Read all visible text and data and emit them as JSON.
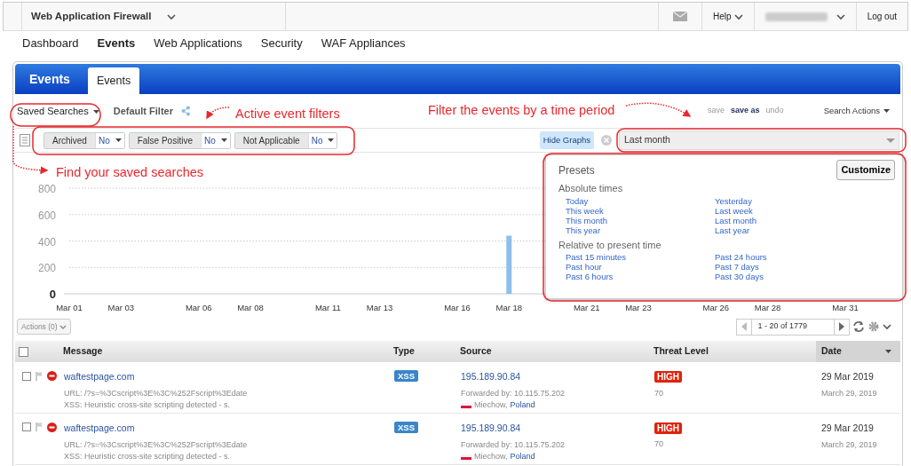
{
  "top_bar": {
    "app_title": "Web Application Firewall",
    "help": "Help",
    "logout": "Log out"
  },
  "main_nav": [
    {
      "label": "Dashboard",
      "selected": false
    },
    {
      "label": "Events",
      "selected": true
    },
    {
      "label": "Web Applications",
      "selected": false
    },
    {
      "label": "Security",
      "selected": false
    },
    {
      "label": "WAF Appliances",
      "selected": false
    }
  ],
  "panel": {
    "title": "Events",
    "tabs": [
      {
        "label": "Events",
        "selected": true
      }
    ]
  },
  "search_bar": {
    "saved_searches": "Saved Searches",
    "filter_name": "Default Filter",
    "actions": [
      {
        "label": "save",
        "disabled": true
      },
      {
        "label": "save as",
        "disabled": false
      },
      {
        "label": "undo",
        "disabled": true
      }
    ],
    "search_actions": "Search Actions"
  },
  "filters": [
    {
      "label": "Archived",
      "value": "No"
    },
    {
      "label": "False Positive",
      "value": "No"
    },
    {
      "label": "Not Applicable",
      "value": "No"
    }
  ],
  "hide_graphs": "Hide Graphs",
  "time_field": {
    "value": "Last month"
  },
  "time_presets": {
    "title": "Presets",
    "customize": "Customize",
    "groups": [
      {
        "title": "Absolute times",
        "columns": [
          [
            "Today",
            "This week",
            "This month",
            "This year"
          ],
          [
            "Yesterday",
            "Last week",
            "Last month",
            "Last year"
          ]
        ]
      },
      {
        "title": "Relative to present time",
        "columns": [
          [
            "Past 15 minutes",
            "Past hour",
            "Past 6 hours"
          ],
          [
            "Past 24 hours",
            "Past 7 days",
            "Past 30 days"
          ]
        ]
      }
    ]
  },
  "chart": {
    "chart_data": {
      "type": "bar",
      "grid": true,
      "ylim": [
        0,
        800
      ],
      "yticks": [
        0,
        200,
        400,
        600,
        800
      ],
      "categories": [
        "Mar 01",
        null,
        "Mar 03",
        null,
        null,
        "Mar 06",
        null,
        "Mar 08",
        null,
        null,
        "Mar 11",
        null,
        "Mar 13",
        null,
        null,
        "Mar 16",
        null,
        "Mar 18",
        null,
        null,
        "Mar 21",
        null,
        "Mar 23",
        null,
        null,
        "Mar 26",
        null,
        "Mar 28",
        null,
        null,
        "Mar 31"
      ],
      "values": [
        null,
        null,
        null,
        null,
        null,
        null,
        null,
        null,
        null,
        null,
        null,
        null,
        null,
        null,
        null,
        null,
        null,
        440,
        null,
        null,
        null,
        null,
        null,
        null,
        null,
        null,
        null,
        null,
        null,
        null,
        null
      ]
    }
  },
  "actions_button": "Actions (0)",
  "pager": "1 - 20 of 1779",
  "table": {
    "all_checked": false,
    "columns": [
      {
        "label": "Message",
        "sorted": false
      },
      {
        "label": "Type",
        "sorted": false
      },
      {
        "label": "Source",
        "sorted": false
      },
      {
        "label": "Threat Level",
        "sorted": false
      },
      {
        "label": "Date",
        "sorted": true
      }
    ],
    "rows": [
      {
        "checked": false,
        "message": "waftestpage.com",
        "url": "URL: /?s=%3Cscript%3E%3C%252Fscript%3Edate",
        "detail": "XSS: Heuristic cross-site scripting detected - s.",
        "type": "XSS",
        "source": "195.189.90.84",
        "forwarded": "Forwarded by: 10.115.75.202",
        "city": "Miechow,",
        "country": "Poland",
        "threat": "HIGH",
        "score": "70",
        "date": "29 Mar 2019",
        "date_long": "March 29, 2019"
      },
      {
        "checked": false,
        "message": "waftestpage.com",
        "url": "URL: /?s=%3Cscript%3E%3C%252Fscript%3Edate",
        "detail": "XSS: Heuristic cross-site scripting detected - s.",
        "type": "XSS",
        "source": "195.189.90.84",
        "forwarded": "Forwarded by: 10.115.75.202",
        "city": "Miechow,",
        "country": "Poland",
        "threat": "HIGH",
        "score": "70",
        "date": "29 Mar 2019",
        "date_long": "March 29, 2019"
      }
    ]
  },
  "annotations": [
    {
      "kind": "filters",
      "text": "Active event filters"
    },
    {
      "kind": "time",
      "text": "Filter the events by a time period"
    },
    {
      "kind": "saved",
      "text": "Find your saved searches"
    }
  ]
}
